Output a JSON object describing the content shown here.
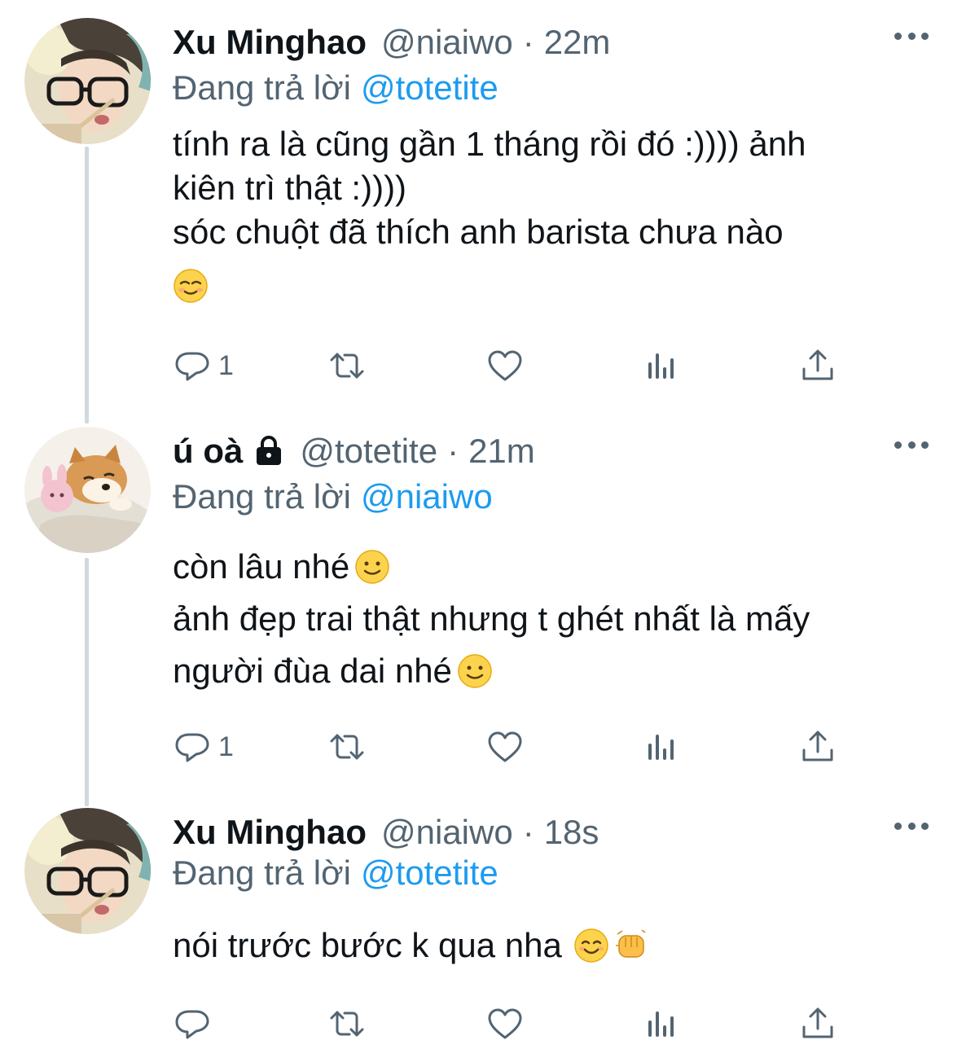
{
  "colors": {
    "accent": "#1d9bf0",
    "muted": "#536471",
    "text": "#0f1419",
    "line": "#cfd9de"
  },
  "tweets": [
    {
      "name": "Xu Minghao",
      "handle": "@niaiwo",
      "separator": "·",
      "time": "22m",
      "reply_prefix": "Đang trả lời",
      "reply_to": "@totetite",
      "lines": [
        "tính ra là cũng gần 1 tháng rồi đó :)))) ảnh",
        "kiên trì thật :))))",
        "sóc chuột đã thích anh barista chưa nào"
      ],
      "emoji_line": "relieved-face-emoji",
      "reply_count": "1"
    },
    {
      "name": "ú oà",
      "handle": "@totetite",
      "separator": "·",
      "time": "21m",
      "protected_icon": "lock-icon",
      "reply_prefix": "Đang trả lời",
      "reply_to": "@niaiwo",
      "lines": [
        "còn lâu nhé",
        "ảnh đẹp trai thật nhưng t ghét nhất là mấy",
        "người đùa dai nhé"
      ],
      "reply_count": "1"
    },
    {
      "name": "Xu Minghao",
      "handle": "@niaiwo",
      "separator": "·",
      "time": "18s",
      "reply_prefix": "Đang trả lời",
      "reply_to": "@totetite",
      "lines": [
        "nói trước bước k qua nha"
      ],
      "reply_count": ""
    }
  ],
  "icons": [
    "reply-icon",
    "retweet-icon",
    "like-icon",
    "analytics-icon",
    "share-icon",
    "more-icon",
    "smiling-face-emoji",
    "punch-emoji"
  ]
}
